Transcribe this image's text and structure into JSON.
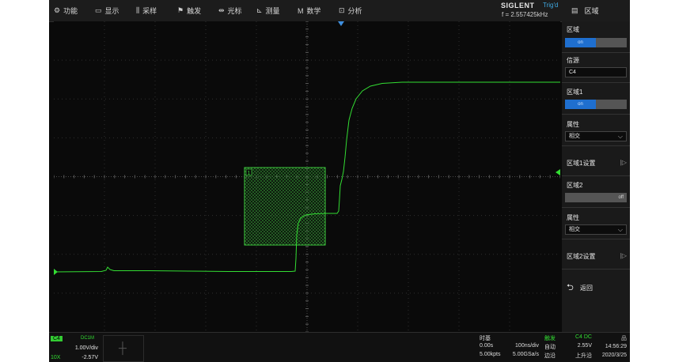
{
  "menu": [
    {
      "icon": "⚙",
      "label": "功能",
      "icon_name": "gear-icon"
    },
    {
      "icon": "▭",
      "label": "显示",
      "icon_name": "display-icon"
    },
    {
      "icon": "⫼",
      "label": "采样",
      "icon_name": "acquire-icon"
    },
    {
      "icon": "⚑",
      "label": "触发",
      "icon_name": "trigger-flag-icon"
    },
    {
      "icon": "⇹",
      "label": "光标",
      "icon_name": "cursor-icon"
    },
    {
      "icon": "⊾",
      "label": "测量",
      "icon_name": "measure-icon"
    },
    {
      "icon": "M",
      "label": "数学",
      "icon_name": "math-icon"
    },
    {
      "icon": "⊡",
      "label": "分析",
      "icon_name": "analysis-icon"
    }
  ],
  "brand": {
    "name": "SIGLENT",
    "status": "Trig'd",
    "frequency": "f = 2.557425kHz"
  },
  "panel": {
    "title": "区域",
    "zone_label": "区域",
    "zone_state": "on",
    "source_label": "信源",
    "source_value": "C4",
    "zone1_label": "区域1",
    "zone1_state": "on",
    "zone1_attr_label": "属性",
    "zone1_attr_value": "相交",
    "zone1_settings": "区域1设置",
    "zone2_label": "区域2",
    "zone2_state": "off",
    "zone2_attr_label": "属性",
    "zone2_attr_value": "相交",
    "zone2_settings": "区域2设置",
    "back_label": "返回"
  },
  "zone_box": {
    "label": "1"
  },
  "channel": {
    "name": "C4",
    "coupling": "DC1M",
    "scale": "1.00V/div",
    "offset": "-2.57V",
    "probe": "10X"
  },
  "timebase": {
    "title": "时基",
    "delay": "0.00s",
    "scale": "100ns/div",
    "memory": "5.00kpts",
    "rate": "5.00GSa/s"
  },
  "trigger": {
    "title": "触发",
    "source": "C4 DC",
    "mode": "自动",
    "level": "2.55V",
    "type": "边沿",
    "slope": "上升沿"
  },
  "clock": {
    "time": "14:56:29",
    "date": "2020/3/25"
  },
  "colors": {
    "trace": "#33dd33",
    "accent": "#1f6fcf",
    "brand_status": "#3fa8e0"
  }
}
